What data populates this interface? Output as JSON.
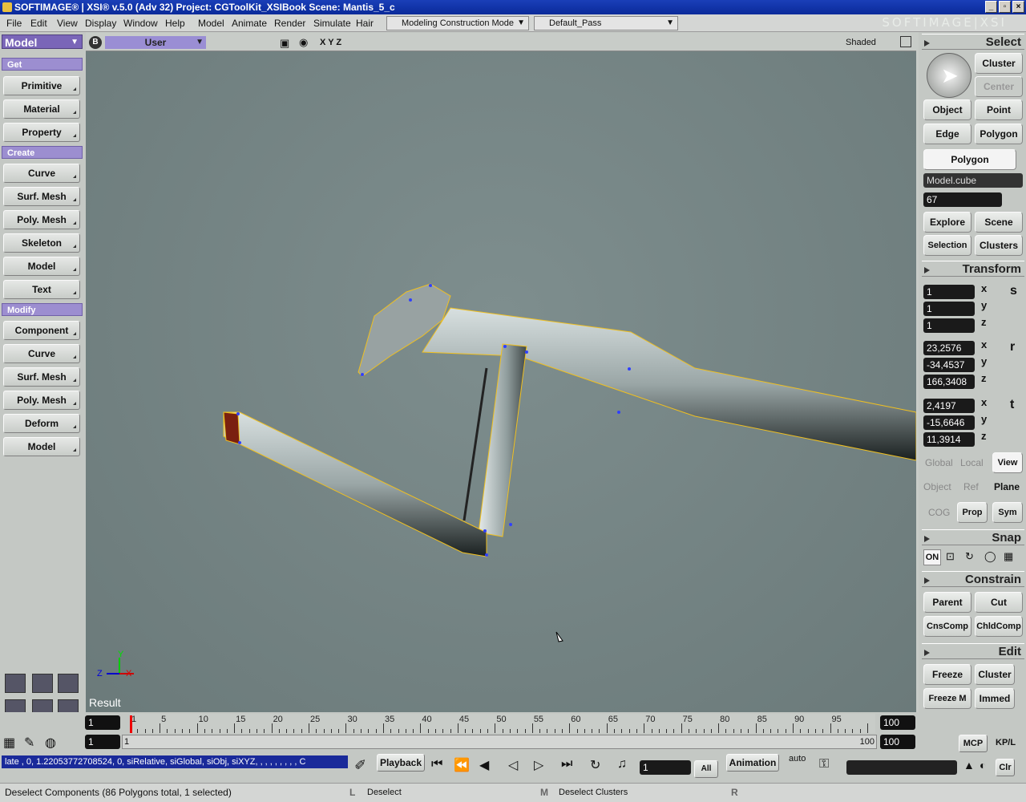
{
  "window": {
    "title": "SOFTIMAGE® | XSI® v.5.0 (Adv 32) Project: CGToolKit_XSIBook    Scene: Mantis_5_c",
    "brand": "SOFTIMAGE|XSI"
  },
  "menus": [
    "File",
    "Edit",
    "View",
    "Display",
    "Window",
    "Help",
    "Model",
    "Animate",
    "Render",
    "Simulate",
    "Hair"
  ],
  "mode_select": "Modeling Construction Mode",
  "pass_select": "Default_Pass",
  "left": {
    "module": "Model",
    "sections": {
      "get": "Get",
      "create": "Create",
      "modify": "Modify"
    },
    "get_items": [
      "Primitive",
      "Material",
      "Property"
    ],
    "create_items": [
      "Curve",
      "Surf. Mesh",
      "Poly. Mesh",
      "Skeleton",
      "Model",
      "Text"
    ],
    "modify_items": [
      "Component",
      "Curve",
      "Surf. Mesh",
      "Poly. Mesh",
      "Deform",
      "Model"
    ]
  },
  "viewport": {
    "camera": "User",
    "axes": "X Y Z",
    "display": "Shaded",
    "label": "Result",
    "axis_x": "X",
    "axis_y": "Y",
    "axis_z": "Z",
    "view_tag": "B"
  },
  "right": {
    "select_head": "Select",
    "cluster": "Cluster",
    "center": "Center",
    "object": "Object",
    "point": "Point",
    "edge": "Edge",
    "polygon": "Polygon",
    "polygon_mode": "Polygon",
    "selected_name": "Model.cube",
    "count": "67",
    "explore": "Explore",
    "scene": "Scene",
    "selection": "Selection",
    "clusters": "Clusters",
    "transform_head": "Transform",
    "scale": [
      "1",
      "1",
      "1"
    ],
    "rotate": [
      "23,2576",
      "-34,4537",
      "166,3408"
    ],
    "translate": [
      "2,4197",
      "-15,6646",
      "11,3914"
    ],
    "x": "x",
    "y": "y",
    "z": "z",
    "s": "s",
    "r": "r",
    "t": "t",
    "global": "Global",
    "local": "Local",
    "view": "View",
    "obj": "Object",
    "ref": "Ref",
    "plane": "Plane",
    "cog": "COG",
    "prop": "Prop",
    "sym": "Sym",
    "snap_head": "Snap",
    "snap_on": "ON",
    "constrain_head": "Constrain",
    "parent": "Parent",
    "cut": "Cut",
    "cnscomp": "CnsComp",
    "chldcomp": "ChldComp",
    "edit_head": "Edit",
    "freeze": "Freeze",
    "cluster2": "Cluster",
    "freeze_m": "Freeze M",
    "immed": "Immed"
  },
  "timeline": {
    "start": "1",
    "end": "100",
    "start2": "1",
    "end2": "100",
    "range_in": "1",
    "range_out": "100",
    "ticks": [
      "1",
      "5",
      "10",
      "15",
      "20",
      "25",
      "30",
      "35",
      "40",
      "45",
      "50",
      "55",
      "60",
      "65",
      "70",
      "75",
      "80",
      "85",
      "90",
      "95"
    ],
    "mcp": "MCP",
    "kpl": "KP/L"
  },
  "command": {
    "script": "late , 0, 1.22053772708524, 0, siRelative, siGlobal, siObj, siXYZ, , , , , , , , , C",
    "playback": "Playback",
    "frame": "1",
    "all": "All",
    "animation": "Animation",
    "auto": "auto",
    "clr": "Clr"
  },
  "status": {
    "message": "Deselect Components (86 Polygons total, 1 selected)",
    "l_key": "L",
    "l_action": "Deselect",
    "m_key": "M",
    "m_action": "Deselect Clusters",
    "r_key": "R"
  }
}
